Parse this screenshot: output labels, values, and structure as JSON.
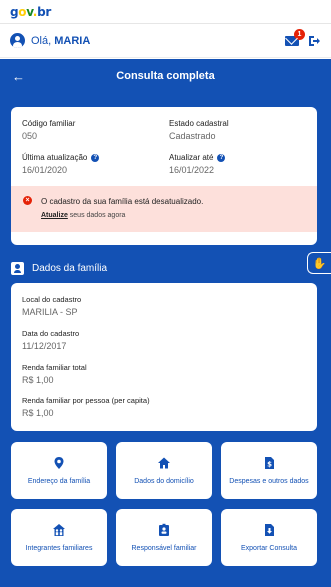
{
  "topbar": {
    "logo_parts": [
      "g",
      "o",
      "v",
      ".",
      "b",
      "r"
    ]
  },
  "user": {
    "greeting": "Olá,",
    "name": "MARIA",
    "notifications": "1"
  },
  "header": {
    "title": "Consulta completa"
  },
  "summary": {
    "codigo_label": "Código familiar",
    "codigo_value": "050",
    "estado_label": "Estado cadastral",
    "estado_value": "Cadastrado",
    "ultima_label": "Última atualização",
    "ultima_value": "16/01/2020",
    "atualizar_label": "Atualizar até",
    "atualizar_value": "16/01/2022"
  },
  "alert": {
    "message": "O cadastro da sua família está desatualizado.",
    "link": "Atualize",
    "rest": " seus dados agora"
  },
  "section": {
    "title": "Dados da família"
  },
  "familia": [
    {
      "label": "Local do cadastro",
      "value": "MARILIA - SP"
    },
    {
      "label": "Data do cadastro",
      "value": "11/12/2017"
    },
    {
      "label": "Renda familiar total",
      "value": "R$ 1,00"
    },
    {
      "label": "Renda familiar por pessoa (per capita)",
      "value": "R$ 1,00"
    }
  ],
  "tiles": [
    {
      "label": "Endereço da família",
      "icon": "map-pin-icon"
    },
    {
      "label": "Dados do domicílio",
      "icon": "home-icon"
    },
    {
      "label": "Despesas e outros dados",
      "icon": "dollar-file-icon"
    },
    {
      "label": "Integrantes familiares",
      "icon": "family-house-icon"
    },
    {
      "label": "Responsável familiar",
      "icon": "id-badge-icon"
    },
    {
      "label": "Exportar Consulta",
      "icon": "download-file-icon"
    }
  ],
  "colors": {
    "primary": "#1351b4",
    "alert_bg": "#fde0db",
    "danger": "#e52207"
  }
}
